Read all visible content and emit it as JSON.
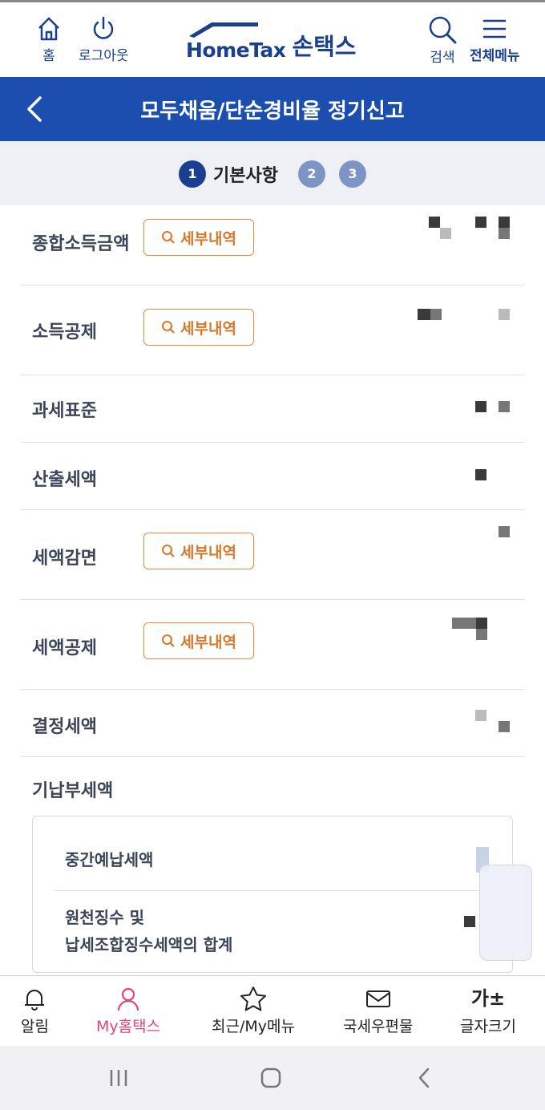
{
  "header": {
    "home_label": "홈",
    "logout_label": "로그아웃",
    "logo_en": "HomeTax",
    "logo_ko": "손택스",
    "search_label": "검색",
    "menu_label": "전체메뉴"
  },
  "title_bar": {
    "title": "모두채움/단순경비율 정기신고"
  },
  "steps": {
    "current_number": "1",
    "current_label": "기본사항",
    "step2": "2",
    "step3": "3"
  },
  "rows": {
    "total_income": "종합소득금액",
    "income_deduction": "소득공제",
    "tax_base": "과세표준",
    "calculated_tax": "산출세액",
    "tax_reduction": "세액감면",
    "tax_credit": "세액공제",
    "determined_tax": "결정세액",
    "prepaid_tax": "기납부세액",
    "detail_button": "세부내역"
  },
  "prepaid": {
    "interim": "중간예납세액",
    "withholding_line1": "원천징수 및",
    "withholding_line2": "납세조합징수세액의 합계"
  },
  "bottom_nav": {
    "alerts": "알림",
    "my_hometax": "My홈택스",
    "recent": "최근/My메뉴",
    "mail": "국세우편물",
    "font_size": "글자크기",
    "font_size_glyph": "가±"
  },
  "colors": {
    "brand": "#1b4eae",
    "accent_orange": "#e48a3b",
    "active_nav": "#e0457a"
  }
}
